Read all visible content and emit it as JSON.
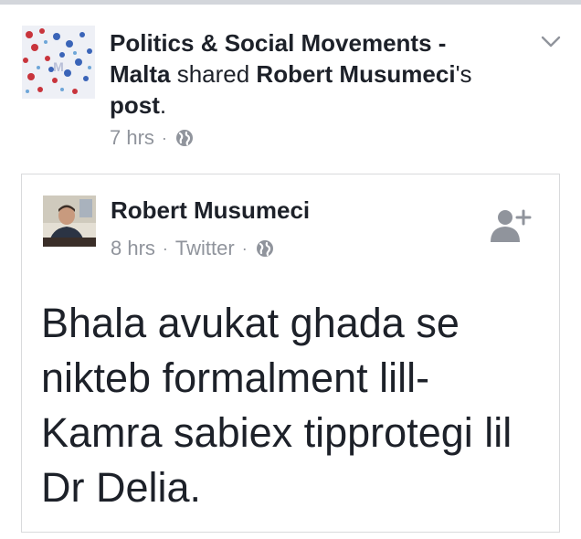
{
  "share": {
    "page_name": "Politics & Social Movements - Malta",
    "verb": " shared ",
    "author_name": "Robert Musumeci",
    "possessive": "'s",
    "object": "post",
    "period": ".",
    "time": "7 hrs",
    "separator": "·"
  },
  "post": {
    "author": "Robert Musumeci",
    "time": "8 hrs",
    "source": "Twitter",
    "separator": "·",
    "text": "Bhala avukat ghada se nikteb formalment lill-Kamra sabiex tipprotegi lil Dr Delia."
  },
  "icons": {
    "privacy": "globe-icon",
    "menu": "chevron-down-icon",
    "add_friend": "add-friend-icon"
  },
  "colors": {
    "text": "#1d2129",
    "meta": "#90949c",
    "border": "#d9dadc",
    "topbar": "#d3d6db",
    "icon": "#90949c"
  }
}
